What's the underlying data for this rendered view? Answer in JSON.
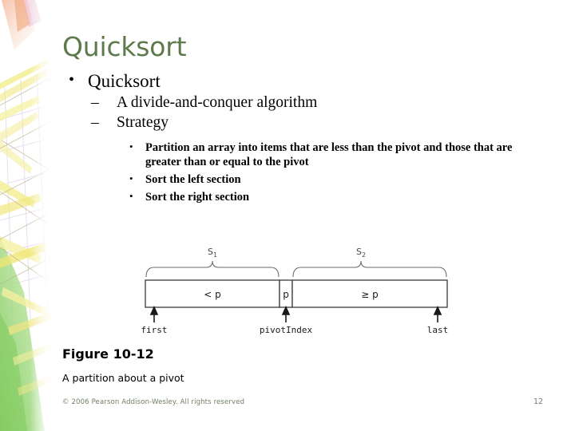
{
  "slide": {
    "title": "Quicksort",
    "title_color": "#5d7a4b",
    "background": "#ffffff"
  },
  "bullets": {
    "level1": "Quicksort",
    "level1_marker": "•",
    "level2_marker": "–",
    "level3_marker": "•",
    "level2": [
      "A divide-and-conquer algorithm",
      "Strategy"
    ],
    "level3": [
      "Partition an array into items that are less than the pivot and those that are greater than or equal to the pivot",
      "Sort the left section",
      "Sort the right section"
    ]
  },
  "figure": {
    "brace_left_label": "S",
    "brace_left_sub": "1",
    "brace_right_label": "S",
    "brace_right_sub": "2",
    "cell_left": "< p",
    "cell_pivot": "p",
    "cell_right": "≥ p",
    "pointer_first": "first",
    "pointer_pivot": "pivotIndex",
    "pointer_last": "last",
    "stroke_color": "#3a3a3a",
    "brace_color": "#6a6a6a"
  },
  "caption": {
    "title": "Figure 10-12",
    "subtitle": "A partition about a pivot"
  },
  "footer": {
    "copyright": "© 2006 Pearson Addison-Wesley. All rights reserved",
    "page_number": "12",
    "color": "#6f7f63"
  },
  "decoration": {
    "name": "scaffolding-watermark",
    "yellow": "#f2ea86",
    "green": "#8fd06a",
    "orange": "#f3b58c",
    "violet": "#e2d2e8"
  }
}
